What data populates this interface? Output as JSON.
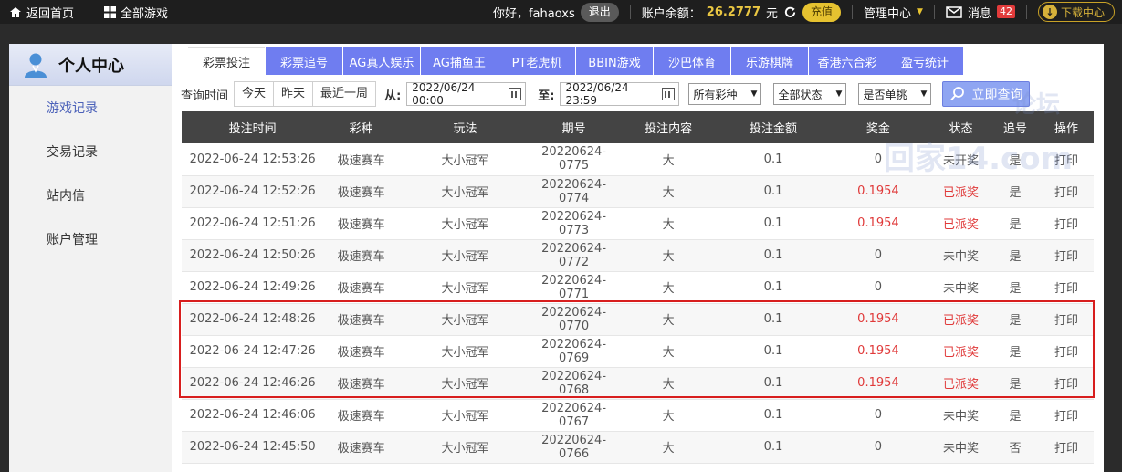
{
  "topbar": {
    "home": "返回首页",
    "all_games": "全部游戏",
    "greeting": "你好，fahaoxs",
    "logout": "退出",
    "balance_label": "账户余额：",
    "balance_value": "26.2777",
    "balance_unit": "元",
    "recharge": "充值",
    "manage": "管理中心",
    "messages": "消息",
    "message_count": "42",
    "download": "下载中心"
  },
  "sidebar": {
    "title": "个人中心",
    "items": [
      "游戏记录",
      "交易记录",
      "站内信",
      "账户管理"
    ]
  },
  "tabs": [
    "彩票投注",
    "彩票追号",
    "AG真人娱乐",
    "AG捕鱼王",
    "PT老虎机",
    "BBIN游戏",
    "沙巴体育",
    "乐游棋牌",
    "香港六合彩",
    "盈亏统计"
  ],
  "filter": {
    "label": "查询时间",
    "quick": [
      "今天",
      "昨天",
      "最近一周"
    ],
    "from_label": "从:",
    "from_value": "2022/06/24 00:00",
    "to_label": "至:",
    "to_value": "2022/06/24 23:59",
    "lottery": "所有彩种",
    "status": "全部状态",
    "single": "是否单挑",
    "search": "立即查询"
  },
  "table": {
    "headers": [
      "投注时间",
      "彩种",
      "玩法",
      "期号",
      "投注内容",
      "投注金额",
      "奖金",
      "状态",
      "追号",
      "操作"
    ],
    "rows": [
      [
        "2022-06-24 12:53:26",
        "极速赛车",
        "大小冠军",
        "20220624-0775",
        "大",
        "0.1",
        "0",
        "未开奖",
        "是",
        "打印"
      ],
      [
        "2022-06-24 12:52:26",
        "极速赛车",
        "大小冠军",
        "20220624-0774",
        "大",
        "0.1",
        "0.1954",
        "已派奖",
        "是",
        "打印"
      ],
      [
        "2022-06-24 12:51:26",
        "极速赛车",
        "大小冠军",
        "20220624-0773",
        "大",
        "0.1",
        "0.1954",
        "已派奖",
        "是",
        "打印"
      ],
      [
        "2022-06-24 12:50:26",
        "极速赛车",
        "大小冠军",
        "20220624-0772",
        "大",
        "0.1",
        "0",
        "未中奖",
        "是",
        "打印"
      ],
      [
        "2022-06-24 12:49:26",
        "极速赛车",
        "大小冠军",
        "20220624-0771",
        "大",
        "0.1",
        "0",
        "未中奖",
        "是",
        "打印"
      ],
      [
        "2022-06-24 12:48:26",
        "极速赛车",
        "大小冠军",
        "20220624-0770",
        "大",
        "0.1",
        "0.1954",
        "已派奖",
        "是",
        "打印"
      ],
      [
        "2022-06-24 12:47:26",
        "极速赛车",
        "大小冠军",
        "20220624-0769",
        "大",
        "0.1",
        "0.1954",
        "已派奖",
        "是",
        "打印"
      ],
      [
        "2022-06-24 12:46:26",
        "极速赛车",
        "大小冠军",
        "20220624-0768",
        "大",
        "0.1",
        "0.1954",
        "已派奖",
        "是",
        "打印"
      ],
      [
        "2022-06-24 12:46:06",
        "极速赛车",
        "大小冠军",
        "20220624-0767",
        "大",
        "0.1",
        "0",
        "未中奖",
        "是",
        "打印"
      ],
      [
        "2022-06-24 12:45:50",
        "极速赛车",
        "大小冠军",
        "20220624-0766",
        "大",
        "0.1",
        "0",
        "未中奖",
        "否",
        "打印"
      ]
    ]
  },
  "watermark": {
    "line1": "论坛",
    "line2": "回家14.com"
  },
  "colors": {
    "tab": "#6f7df0",
    "highlight": "#d81e1e",
    "win": "#e03a3a",
    "gold": "#e6c230"
  }
}
